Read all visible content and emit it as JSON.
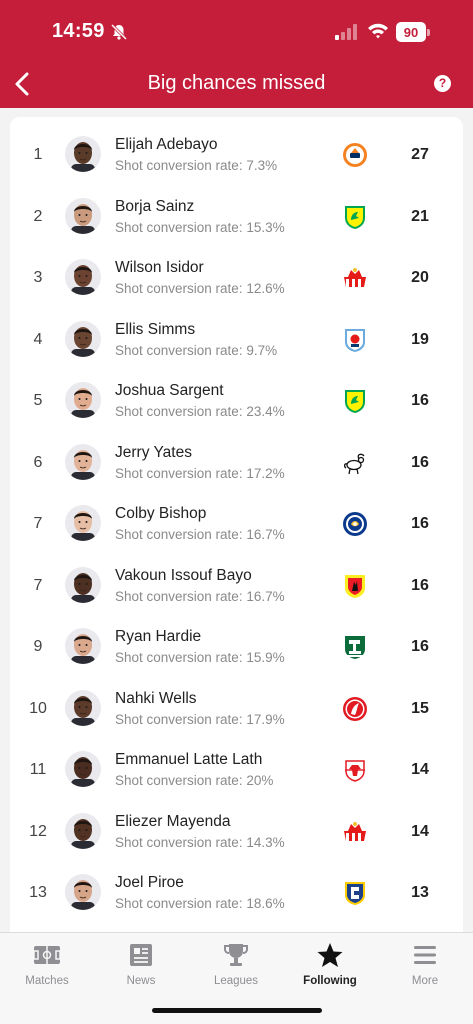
{
  "status_bar": {
    "time": "14:59",
    "battery": "90"
  },
  "header": {
    "title": "Big chances missed",
    "help_label": "?"
  },
  "rows": [
    {
      "rank": "1",
      "name": "Elijah Adebayo",
      "sub": "Shot conversion rate: 7.3%",
      "value": "27",
      "skin": "#5a3a28",
      "club": "luton"
    },
    {
      "rank": "2",
      "name": "Borja Sainz",
      "sub": "Shot conversion rate: 15.3%",
      "value": "21",
      "skin": "#c99a7d",
      "club": "norwich"
    },
    {
      "rank": "3",
      "name": "Wilson Isidor",
      "sub": "Shot conversion rate: 12.6%",
      "value": "20",
      "skin": "#6b4330",
      "club": "sunderland"
    },
    {
      "rank": "4",
      "name": "Ellis Simms",
      "sub": "Shot conversion rate: 9.7%",
      "value": "19",
      "skin": "#6a4632",
      "club": "coventry"
    },
    {
      "rank": "5",
      "name": "Joshua Sargent",
      "sub": "Shot conversion rate: 23.4%",
      "value": "16",
      "skin": "#e0ab8f",
      "club": "norwich"
    },
    {
      "rank": "6",
      "name": "Jerry Yates",
      "sub": "Shot conversion rate: 17.2%",
      "value": "16",
      "skin": "#e2b399",
      "club": "derby"
    },
    {
      "rank": "7",
      "name": "Colby Bishop",
      "sub": "Shot conversion rate: 16.7%",
      "value": "16",
      "skin": "#e6bea6",
      "club": "portsmouth"
    },
    {
      "rank": "7",
      "name": "Vakoun Issouf Bayo",
      "sub": "Shot conversion rate: 16.7%",
      "value": "16",
      "skin": "#4e3022",
      "club": "watford"
    },
    {
      "rank": "9",
      "name": "Ryan Hardie",
      "sub": "Shot conversion rate: 15.9%",
      "value": "16",
      "skin": "#d9a88d",
      "club": "plymouth"
    },
    {
      "rank": "10",
      "name": "Nahki Wells",
      "sub": "Shot conversion rate: 17.9%",
      "value": "15",
      "skin": "#5d3b2a",
      "club": "bristol"
    },
    {
      "rank": "11",
      "name": "Emmanuel Latte Lath",
      "sub": "Shot conversion rate: 20%",
      "value": "14",
      "skin": "#4a2d20",
      "club": "middlesbrough"
    },
    {
      "rank": "12",
      "name": "Eliezer Mayenda",
      "sub": "Shot conversion rate: 14.3%",
      "value": "14",
      "skin": "#513223",
      "club": "sunderland"
    },
    {
      "rank": "13",
      "name": "Joel Piroe",
      "sub": "Shot conversion rate: 18.6%",
      "value": "13",
      "skin": "#d6a488",
      "club": "leeds"
    }
  ],
  "tabs": [
    {
      "label": "Matches",
      "icon": "pitch-icon",
      "active": false
    },
    {
      "label": "News",
      "icon": "news-icon",
      "active": false
    },
    {
      "label": "Leagues",
      "icon": "trophy-icon",
      "active": false
    },
    {
      "label": "Following",
      "icon": "star-icon",
      "active": true
    },
    {
      "label": "More",
      "icon": "menu-icon",
      "active": false
    }
  ],
  "colors": {
    "brand": "#c41e3a",
    "muted": "#8e8e93"
  }
}
